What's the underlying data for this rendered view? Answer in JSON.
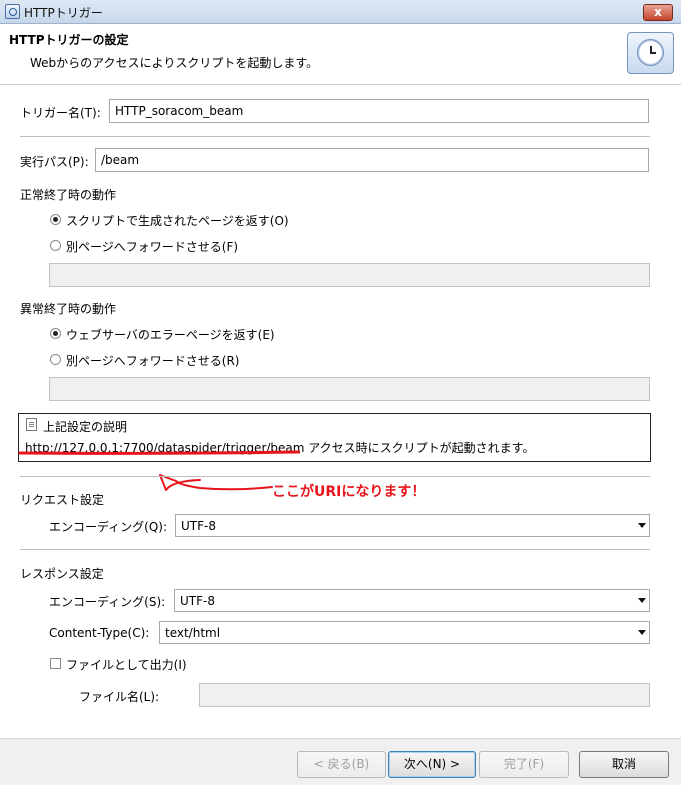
{
  "window": {
    "title": "HTTPトリガー",
    "close_label": "x"
  },
  "header": {
    "title": "HTTPトリガーの設定",
    "description": "Webからのアクセスによりスクリプトを起動します。",
    "icon": "clock-icon"
  },
  "trigger": {
    "name_label": "トリガー名(T):",
    "name_value": "HTTP_soracom_beam"
  },
  "path": {
    "label": "実行パス(P):",
    "value": "/beam"
  },
  "on_success": {
    "heading": "正常終了時の動作",
    "options": [
      {
        "label": "スクリプトで生成されたページを返す(O)",
        "checked": true
      },
      {
        "label": "別ページへフォワードさせる(F)",
        "checked": false
      }
    ],
    "forward_value": ""
  },
  "on_error": {
    "heading": "異常終了時の動作",
    "options": [
      {
        "label": "ウェブサーバのエラーページを返す(E)",
        "checked": true
      },
      {
        "label": "別ページへフォワードさせる(R)",
        "checked": false
      }
    ],
    "forward_value": ""
  },
  "info": {
    "heading": "上記設定の説明",
    "url": "http://127.0.0.1:7700/dataspider/trigger/beam",
    "suffix": " アクセス時にスクリプトが起動されます。"
  },
  "annotation": {
    "text": "ここがURIになります！",
    "color": "#e8141b"
  },
  "request": {
    "heading": "リクエスト設定",
    "encoding_label": "エンコーディング(Q):",
    "encoding_value": "UTF-8"
  },
  "response": {
    "heading": "レスポンス設定",
    "encoding_label": "エンコーディング(S):",
    "encoding_value": "UTF-8",
    "content_type_label": "Content-Type(C):",
    "content_type_value": "text/html",
    "file_output_label": "ファイルとして出力(I)",
    "file_output_checked": false,
    "filename_label": "ファイル名(L):",
    "filename_value": ""
  },
  "buttons": {
    "back": "< 戻る(B)",
    "next": "次へ(N) >",
    "finish": "完了(F)",
    "cancel": "取消"
  }
}
